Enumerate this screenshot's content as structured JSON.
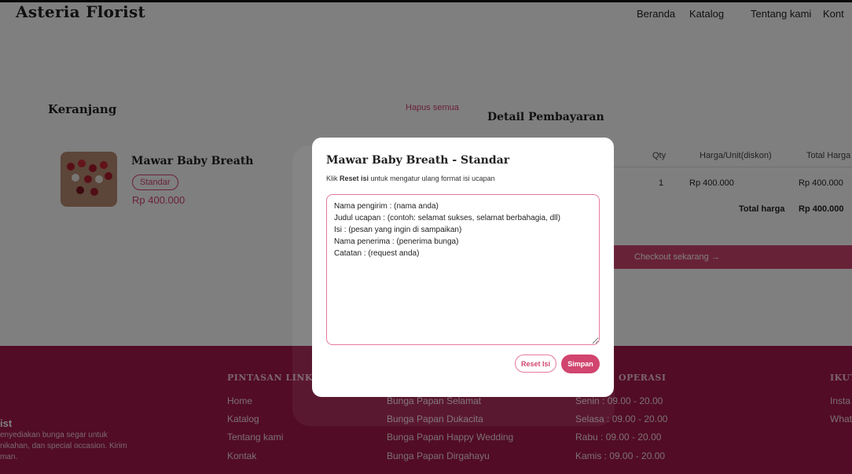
{
  "header": {
    "brand": "Asteria Florist",
    "nav": [
      "Beranda",
      "Katalog",
      "Tentang kami",
      "Kont"
    ]
  },
  "cart": {
    "title": "Keranjang",
    "clear_all": "Hapus semua",
    "item": {
      "name": "Mawar Baby Breath",
      "variant": "Standar",
      "price": "Rp 400.000"
    }
  },
  "payment": {
    "title": "Detail Pembayaran",
    "columns": [
      "Qty",
      "Harga/Unit(diskon)",
      "Total Harga"
    ],
    "row": [
      "1",
      "Rp 400.000",
      "Rp 400.000"
    ],
    "total_label": "Total harga",
    "total_value": "Rp 400.000",
    "checkout": "Checkout sekarang →"
  },
  "footer": {
    "brand": "ist",
    "desc": [
      "enyediakan bunga segar untuk",
      "nikahan, dan special occasion. Kirim",
      "man."
    ],
    "shortcut_title": "PINTASAN LINK",
    "shortcut_links": [
      "Home",
      "Katalog",
      "Tentang kami",
      "Kontak"
    ],
    "products": [
      "Bunga Papan Selamat",
      "Bunga Papan Dukacita",
      "Bunga Papan Happy Wedding",
      "Bunga Papan Dirgahayu"
    ],
    "hours_title": "OPERASI",
    "hours": [
      "Senin : 09.00 - 20.00",
      "Selasa : 09.00 - 20.00",
      "Rabu : 09.00 - 20.00",
      "Kamis : 09.00 - 20.00"
    ],
    "follow_title": "IKUT",
    "follow": [
      "Insta",
      "What"
    ]
  },
  "modal": {
    "title": "Mawar Baby Breath - Standar",
    "hint_prefix": "Klik ",
    "hint_bold": "Reset isi",
    "hint_suffix": " untuk mengatur ulang format isi ucapan",
    "message": "Nama pengirim : (nama anda)\nJudul ucapan : (contoh: selamat sukses, selamat berbahagia, dll)\nIsi : (pesan yang ingin di sampaikan)\nNama penerima : (penerima bunga)\nCatatan : (request anda)",
    "reset_label": "Reset Isi",
    "save_label": "Simpan"
  },
  "colors": {
    "accent": "#d1456e",
    "footer": "#a4184a"
  }
}
